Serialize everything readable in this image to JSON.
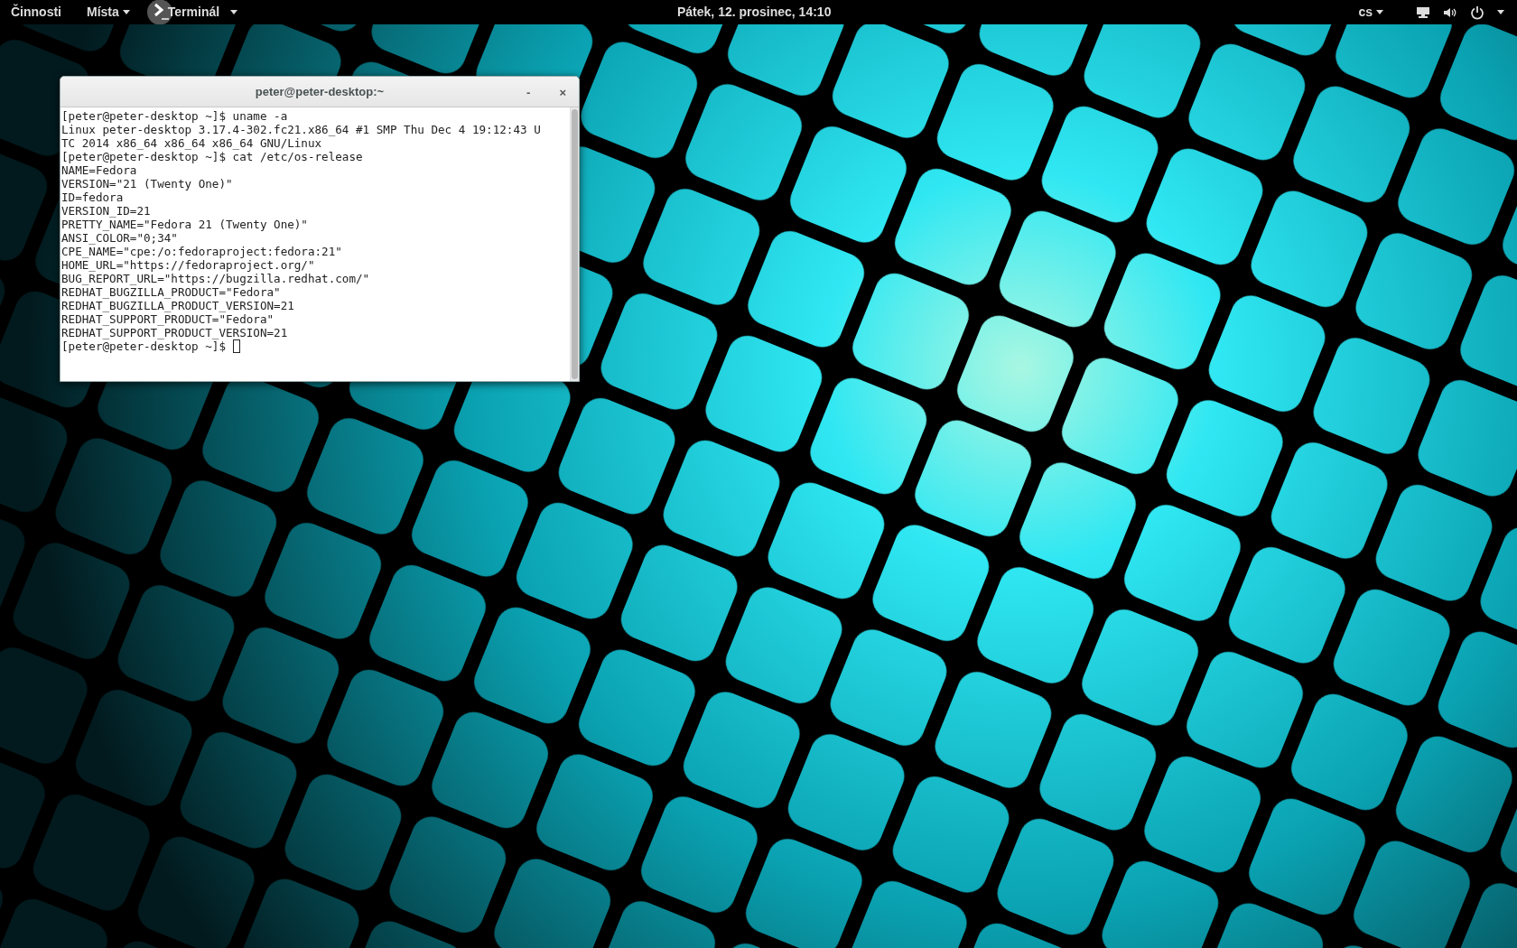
{
  "top_bar": {
    "activities": "Činnosti",
    "places": "Místa",
    "app_menu": "Terminál",
    "clock": "Pátek, 12. prosinec, 14:10",
    "keyboard_layout": "cs"
  },
  "terminal_window": {
    "title": "peter@peter-desktop:~",
    "minimize": "-",
    "close": "×",
    "lines": [
      "[peter@peter-desktop ~]$ uname -a",
      "Linux peter-desktop 3.17.4-302.fc21.x86_64 #1 SMP Thu Dec 4 19:12:43 U",
      "TC 2014 x86_64 x86_64 x86_64 GNU/Linux",
      "[peter@peter-desktop ~]$ cat /etc/os-release",
      "NAME=Fedora",
      "VERSION=\"21 (Twenty One)\"",
      "ID=fedora",
      "VERSION_ID=21",
      "PRETTY_NAME=\"Fedora 21 (Twenty One)\"",
      "ANSI_COLOR=\"0;34\"",
      "CPE_NAME=\"cpe:/o:fedoraproject:fedora:21\"",
      "HOME_URL=\"https://fedoraproject.org/\"",
      "BUG_REPORT_URL=\"https://bugzilla.redhat.com/\"",
      "REDHAT_BUGZILLA_PRODUCT=\"Fedora\"",
      "REDHAT_BUGZILLA_PRODUCT_VERSION=21",
      "REDHAT_SUPPORT_PRODUCT=\"Fedora\"",
      "REDHAT_SUPPORT_PRODUCT_VERSION=21",
      "[peter@peter-desktop ~]$ "
    ]
  }
}
